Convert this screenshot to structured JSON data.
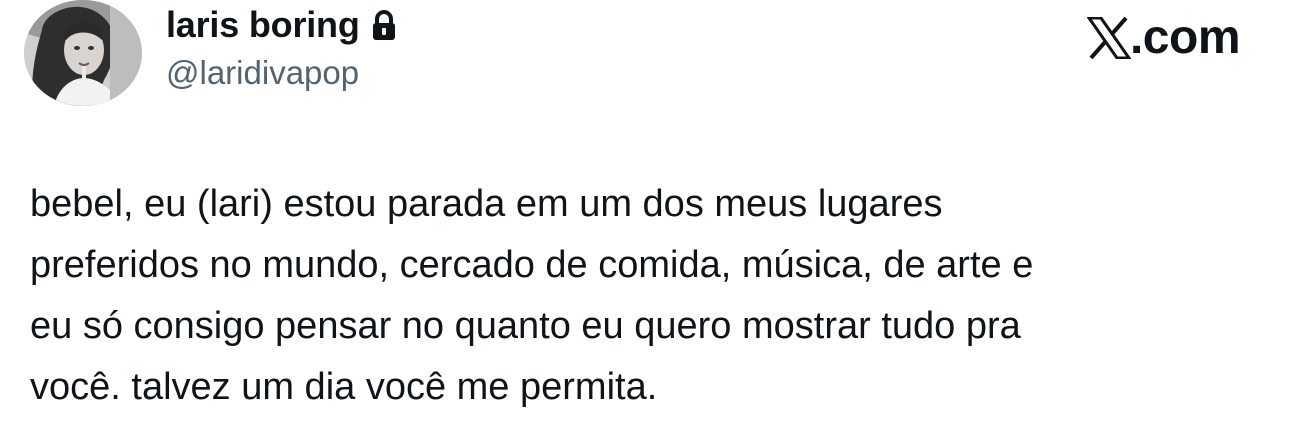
{
  "author": {
    "display_name": "laris boring",
    "handle": "@laridivapop",
    "avatar_icon": "profile-photo",
    "protected_icon": "lock-icon"
  },
  "brand": {
    "logo_icon": "x-logo-icon",
    "text": ".com"
  },
  "tweet": {
    "lines": [
      "bebel, eu (lari) estou parada em um dos meus lugares",
      "preferidos no mundo, cercado de comida, música, de arte e",
      "eu só consigo pensar no quanto eu quero mostrar tudo pra",
      "você. talvez um dia você me permita."
    ]
  },
  "colors": {
    "text_primary": "#0f1419",
    "text_secondary": "#536471",
    "background": "#ffffff"
  }
}
